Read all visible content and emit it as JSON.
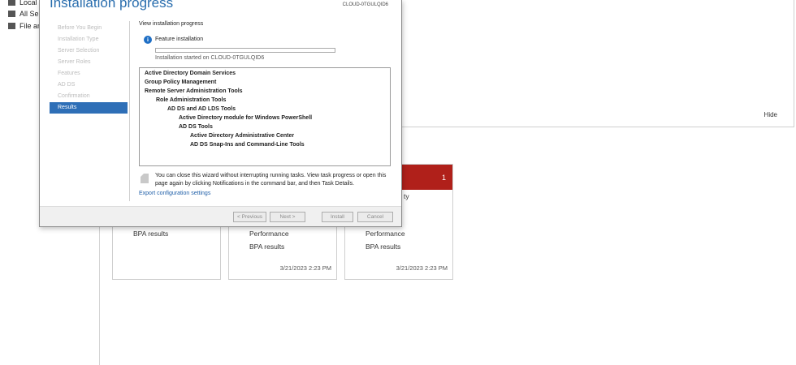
{
  "background": {
    "nav_items": [
      "Local Se",
      "All Serv",
      "File and"
    ],
    "hide_label": "Hide",
    "tiles": [
      {
        "rows": [
          "BPA results"
        ],
        "timestamp": ""
      },
      {
        "rows": [
          "Performance",
          "BPA results"
        ],
        "timestamp": "3/21/2023 2:23 PM"
      },
      {
        "rows": [
          "Performance",
          "BPA results"
        ],
        "timestamp": "3/21/2023 2:23 PM",
        "header_count": "1",
        "fragment": "ty"
      }
    ]
  },
  "wizard": {
    "title": "Installation progress",
    "destination_server": "CLOUD-0TGULQID6",
    "steps": [
      "Before You Begin",
      "Installation Type",
      "Server Selection",
      "Server Roles",
      "Features",
      "AD DS",
      "Confirmation",
      "Results"
    ],
    "active_step": "Results",
    "view_progress": "View installation progress",
    "feature_installation": "Feature installation",
    "progress_fraction": 0.0,
    "started_text": "Installation started on CLOUD-0TGULQID6",
    "results_items": [
      "Active Directory Domain Services",
      "Group Policy Management",
      "Remote Server Administration Tools",
      "Role Administration Tools",
      "AD DS and AD LDS Tools",
      "Active Directory module for Windows PowerShell",
      "AD DS Tools",
      "Active Directory Administrative Center",
      "AD DS Snap-Ins and Command-Line Tools"
    ],
    "note": "You can close this wizard without interrupting running tasks. View task progress or open this page again by clicking Notifications in the command bar, and then Task Details.",
    "export_link": "Export configuration settings",
    "buttons": {
      "previous": "< Previous",
      "next": "Next >",
      "install": "Install",
      "cancel": "Cancel"
    }
  }
}
